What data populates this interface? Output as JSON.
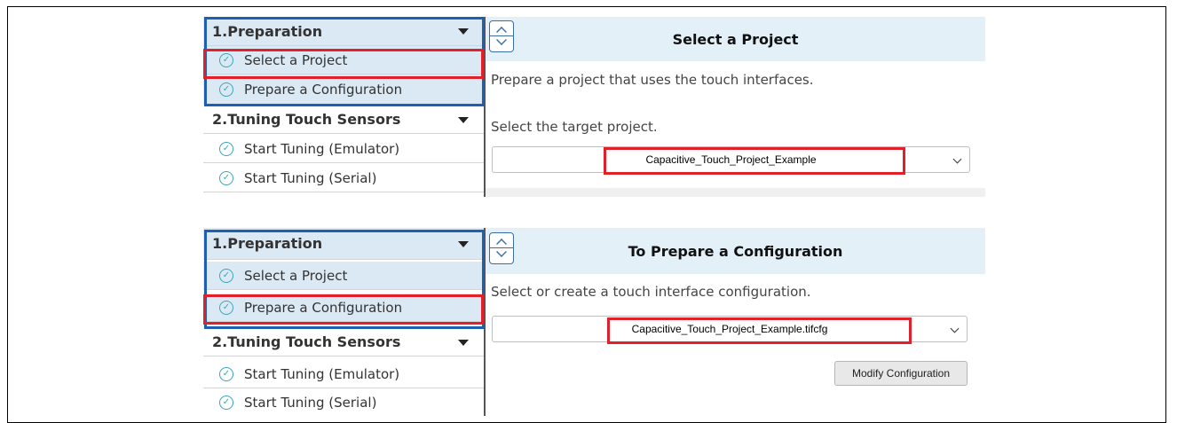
{
  "panels": [
    {
      "sidebar": {
        "section1": "1.Preparation",
        "items1": [
          "Select a Project",
          "Prepare a Configuration"
        ],
        "section2": "2.Tuning Touch Sensors",
        "items2": [
          "Start Tuning (Emulator)",
          "Start Tuning (Serial)"
        ]
      },
      "title": "Select a Project",
      "description": "Prepare a project that uses the touch interfaces.",
      "prompt": "Select the target project.",
      "select_value": "Capacitive_Touch_Project_Example"
    },
    {
      "sidebar": {
        "section1": "1.Preparation",
        "items1": [
          "Select a Project",
          "Prepare a Configuration"
        ],
        "section2": "2.Tuning Touch Sensors",
        "items2": [
          "Start Tuning (Emulator)",
          "Start Tuning (Serial)"
        ]
      },
      "title": "To Prepare a Configuration",
      "description": "Select or create a touch interface configuration.",
      "select_value": "Capacitive_Touch_Project_Example.tifcfg",
      "button_label": "Modify Configuration"
    }
  ],
  "colors": {
    "highlight_red": "#e0202a",
    "highlight_blue": "#1f5fb0",
    "selected_bg": "#dbe9f4",
    "titlebar_bg": "#e3f0f8",
    "check": "#3aa6b9"
  },
  "icons": [
    "check-circle-icon",
    "caret-down-icon",
    "chevron-up-icon",
    "chevron-down-icon"
  ]
}
